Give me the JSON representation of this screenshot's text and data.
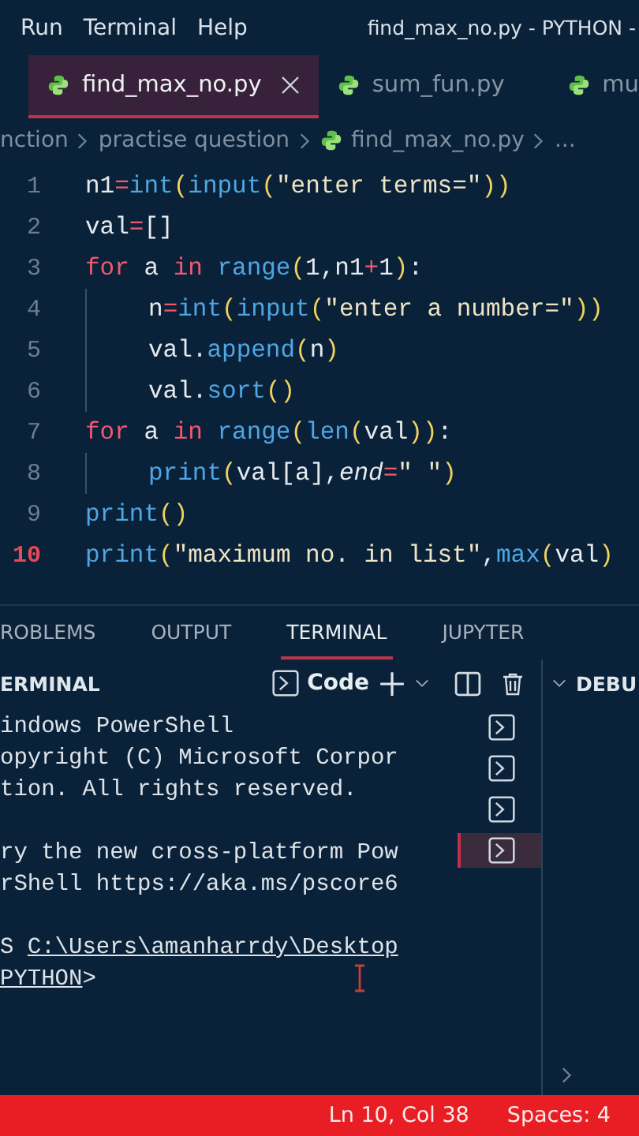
{
  "menu": {
    "items": [
      "Run",
      "Terminal",
      "Help"
    ],
    "title": "find_max_no.py - PYTHON -"
  },
  "tabs": [
    {
      "label": "find_max_no.py",
      "selected": true
    },
    {
      "label": "sum_fun.py",
      "selected": false
    },
    {
      "label": "mu",
      "selected": false
    }
  ],
  "breadcrumbs": {
    "folders": [
      "nction",
      "practise question"
    ],
    "file": "find_max_no.py",
    "more": "..."
  },
  "code": {
    "lines": [
      {
        "number": "1",
        "current": false,
        "tokens": [
          {
            "text": "n1",
            "kind": "plain"
          },
          {
            "text": "=",
            "kind": "op"
          },
          {
            "text": "int",
            "kind": "fn"
          },
          {
            "text": "(",
            "kind": "bracket"
          },
          {
            "text": "input",
            "kind": "fn"
          },
          {
            "text": "(",
            "kind": "bracket"
          },
          {
            "text": "\"enter terms=\"",
            "kind": "str"
          },
          {
            "text": "))",
            "kind": "bracket"
          }
        ]
      },
      {
        "number": "2",
        "current": false,
        "tokens": [
          {
            "text": "val",
            "kind": "plain"
          },
          {
            "text": "=",
            "kind": "op"
          },
          {
            "text": "[]",
            "kind": "plain"
          }
        ]
      },
      {
        "number": "3",
        "current": false,
        "tokens": [
          {
            "text": "for",
            "kind": "kw"
          },
          {
            "text": " a ",
            "kind": "plain"
          },
          {
            "text": "in",
            "kind": "kw"
          },
          {
            "text": " range",
            "kind": "fn"
          },
          {
            "text": "(",
            "kind": "bracket"
          },
          {
            "text": "1,n1",
            "kind": "plain"
          },
          {
            "text": "+",
            "kind": "op"
          },
          {
            "text": "1",
            "kind": "plain"
          },
          {
            "text": ")",
            "kind": "bracket"
          },
          {
            "text": ":",
            "kind": "plain"
          }
        ],
        "children": [
          {
            "number": "4",
            "current": false,
            "tokens": [
              {
                "text": "n",
                "kind": "plain"
              },
              {
                "text": "=",
                "kind": "op"
              },
              {
                "text": "int",
                "kind": "fn"
              },
              {
                "text": "(",
                "kind": "bracket"
              },
              {
                "text": "input",
                "kind": "fn"
              },
              {
                "text": "(",
                "kind": "bracket"
              },
              {
                "text": "\"enter a number=\"",
                "kind": "str"
              },
              {
                "text": "))",
                "kind": "bracket"
              }
            ]
          },
          {
            "number": "5",
            "current": false,
            "tokens": [
              {
                "text": "val.",
                "kind": "plain"
              },
              {
                "text": "append",
                "kind": "fn"
              },
              {
                "text": "(",
                "kind": "bracket"
              },
              {
                "text": "n",
                "kind": "plain"
              },
              {
                "text": ")",
                "kind": "bracket"
              }
            ]
          },
          {
            "number": "6",
            "current": false,
            "tokens": [
              {
                "text": "val.",
                "kind": "plain"
              },
              {
                "text": "sort",
                "kind": "fn"
              },
              {
                "text": "()",
                "kind": "bracket"
              }
            ]
          }
        ]
      },
      {
        "number": "7",
        "current": false,
        "tokens": [
          {
            "text": "for",
            "kind": "kw"
          },
          {
            "text": " a ",
            "kind": "plain"
          },
          {
            "text": "in",
            "kind": "kw"
          },
          {
            "text": " range",
            "kind": "fn"
          },
          {
            "text": "(",
            "kind": "bracket"
          },
          {
            "text": "len",
            "kind": "fn"
          },
          {
            "text": "(",
            "kind": "bracket"
          },
          {
            "text": "val",
            "kind": "plain"
          },
          {
            "text": "))",
            "kind": "bracket"
          },
          {
            "text": ":",
            "kind": "plain"
          }
        ],
        "children": [
          {
            "number": "8",
            "current": false,
            "tokens": [
              {
                "text": "print",
                "kind": "fn"
              },
              {
                "text": "(",
                "kind": "bracket"
              },
              {
                "text": "val[a],",
                "kind": "plain"
              },
              {
                "text": "end",
                "kind": "param"
              },
              {
                "text": "=",
                "kind": "op"
              },
              {
                "text": "\" \"",
                "kind": "str"
              },
              {
                "text": ")",
                "kind": "bracket"
              }
            ]
          }
        ]
      },
      {
        "number": "9",
        "current": false,
        "tokens": [
          {
            "text": "print",
            "kind": "fn"
          },
          {
            "text": "()",
            "kind": "bracket"
          }
        ]
      },
      {
        "number": "10",
        "current": true,
        "tokens": [
          {
            "text": "print",
            "kind": "fn"
          },
          {
            "text": "(",
            "kind": "bracket"
          },
          {
            "text": "\"maximum no. in list\"",
            "kind": "str"
          },
          {
            "text": ",",
            "kind": "plain"
          },
          {
            "text": "max",
            "kind": "fn"
          },
          {
            "text": "(",
            "kind": "bracket"
          },
          {
            "text": "val",
            "kind": "plain"
          },
          {
            "text": ")",
            "kind": "bracket"
          }
        ]
      }
    ]
  },
  "panel": {
    "tabs": [
      {
        "label": "ROBLEMS",
        "selected": false
      },
      {
        "label": "OUTPUT",
        "selected": false
      },
      {
        "label": "TERMINAL",
        "selected": true
      },
      {
        "label": "JUPYTER",
        "selected": false
      }
    ],
    "terminal_title": "ERMINAL",
    "profile": "Code",
    "terminal": [
      [
        [
          {
            "text": "indows PowerShell",
            "link": false
          }
        ],
        [
          {
            "text": "opyright (C) Microsoft Corpor",
            "link": false
          }
        ],
        [
          {
            "text": "tion. All rights reserved.",
            "link": false
          }
        ]
      ],
      [
        [
          {
            "text": "ry the new cross-platform Pow",
            "link": false
          }
        ],
        [
          {
            "text": "rShell https://aka.ms/pscore6",
            "link": false
          }
        ]
      ],
      [
        [
          {
            "text": "S ",
            "link": false
          },
          {
            "text": "C:\\Users\\amanharrdy\\Desktop",
            "link": true
          }
        ],
        [
          {
            "text": "PYTHON",
            "link": true
          },
          {
            "text": ">",
            "link": false
          }
        ]
      ]
    ],
    "terminal_list": [
      {
        "selected": false
      },
      {
        "selected": false
      },
      {
        "selected": false
      },
      {
        "selected": true
      }
    ],
    "side_title": "DEBU"
  },
  "status_bar": [
    "Ln 10, Col 38",
    "Spaces: 4"
  ]
}
